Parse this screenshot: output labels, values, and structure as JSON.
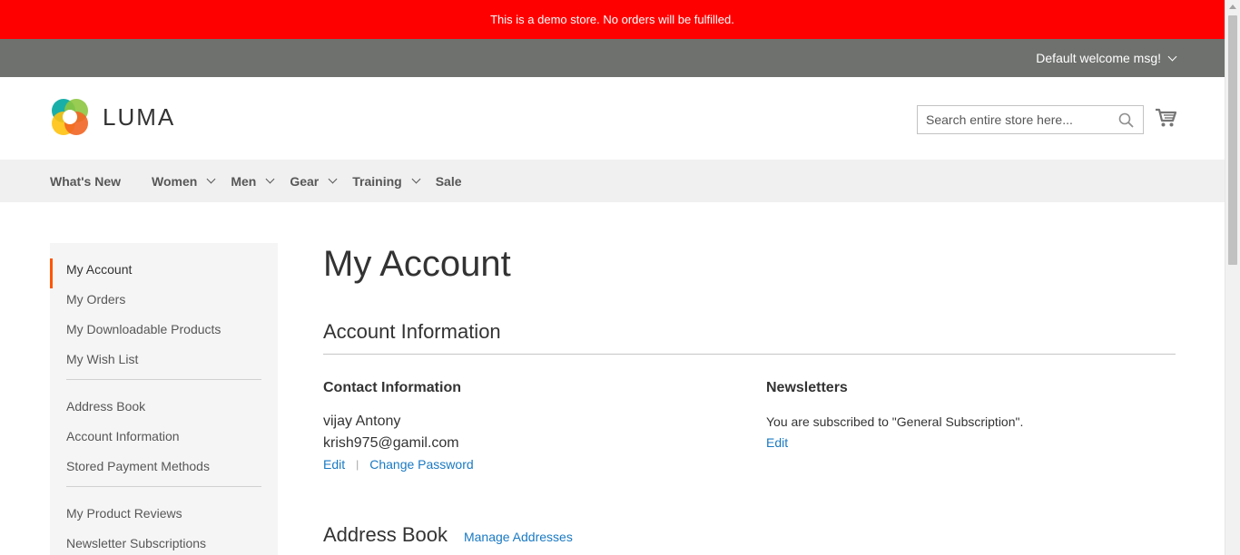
{
  "demo_notice": "This is a demo store. No orders will be fulfilled.",
  "panel": {
    "welcome": "Default welcome msg!"
  },
  "header": {
    "logo_text": "LUMA",
    "search_placeholder": "Search entire store here..."
  },
  "nav": {
    "items": [
      {
        "label": "What's New",
        "has_sub": false
      },
      {
        "label": "Women",
        "has_sub": true
      },
      {
        "label": "Men",
        "has_sub": true
      },
      {
        "label": "Gear",
        "has_sub": true
      },
      {
        "label": "Training",
        "has_sub": true
      },
      {
        "label": "Sale",
        "has_sub": false
      }
    ]
  },
  "sidebar": {
    "items": [
      {
        "label": "My Account"
      },
      {
        "label": "My Orders"
      },
      {
        "label": "My Downloadable Products"
      },
      {
        "label": "My Wish List"
      },
      {
        "label": "Address Book"
      },
      {
        "label": "Account Information"
      },
      {
        "label": "Stored Payment Methods"
      },
      {
        "label": "My Product Reviews"
      },
      {
        "label": "Newsletter Subscriptions"
      }
    ]
  },
  "main": {
    "page_title": "My Account",
    "account_info_title": "Account Information",
    "contact": {
      "title": "Contact Information",
      "name": "vijay Antony",
      "email": "krish975@gamil.com",
      "edit_label": "Edit",
      "change_password_label": "Change Password"
    },
    "newsletters": {
      "title": "Newsletters",
      "text": "You are subscribed to \"General Subscription\".",
      "edit_label": "Edit"
    },
    "address_book": {
      "title": "Address Book",
      "manage_label": "Manage Addresses"
    }
  },
  "colors": {
    "demo_bar": "#ff0000",
    "panel_header": "#6e716e",
    "nav_bg": "#f0f0f0",
    "link": "#1979c3",
    "active_marker": "#ff5501"
  }
}
